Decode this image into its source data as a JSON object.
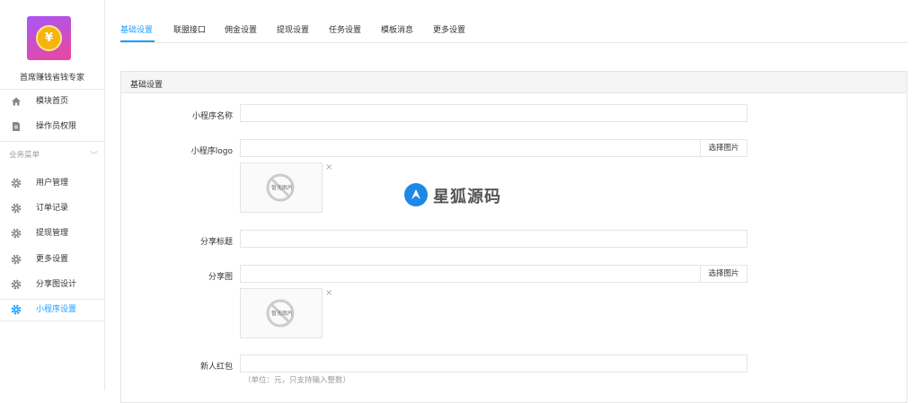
{
  "sidebar": {
    "app_name": "首席赚钱省钱专家",
    "logo_symbol": "¥",
    "top_items": [
      {
        "label": "模块首页",
        "icon": "home-icon"
      },
      {
        "label": "操作员权限",
        "icon": "document-icon"
      }
    ],
    "section_label": "业务菜单",
    "menu_items": [
      {
        "label": "用户管理",
        "icon": "gear-icon"
      },
      {
        "label": "订单记录",
        "icon": "gear-icon"
      },
      {
        "label": "提现管理",
        "icon": "gear-icon"
      },
      {
        "label": "更多设置",
        "icon": "gear-icon"
      },
      {
        "label": "分享图设计",
        "icon": "gear-icon"
      },
      {
        "label": "小程序设置",
        "icon": "gear-icon",
        "active": true
      }
    ]
  },
  "tabs": [
    "基础设置",
    "联盟接口",
    "佣金设置",
    "提现设置",
    "任务设置",
    "模板消息",
    "更多设置"
  ],
  "active_tab": 0,
  "panel": {
    "title": "基础设置",
    "fields": {
      "mini_name": {
        "label": "小程序名称",
        "value": ""
      },
      "mini_logo": {
        "label": "小程序logo",
        "value": "",
        "button": "选择图片",
        "thumb_text": "暂无图片"
      },
      "share_title": {
        "label": "分享标题",
        "value": ""
      },
      "share_image": {
        "label": "分享图",
        "value": "",
        "button": "选择图片",
        "thumb_text": "暂无图片"
      },
      "new_redpack": {
        "label": "新人红包",
        "value": "",
        "help": "（单位：元，只支持输入整数）"
      }
    }
  },
  "watermark": {
    "text": "星狐源码"
  },
  "colors": {
    "accent": "#1e9fff",
    "border": "#e5e5e5",
    "panel_head": "#f5f5f5"
  }
}
